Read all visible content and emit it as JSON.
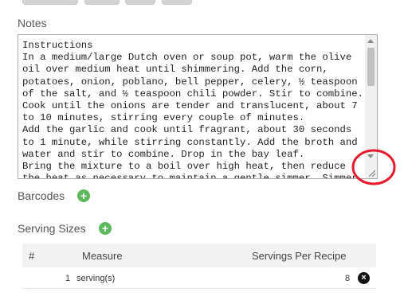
{
  "notes": {
    "label": "Notes",
    "text": "Instructions\nIn a medium/large Dutch oven or soup pot, warm the olive oil over medium heat until shimmering. Add the corn, potatoes, onion, poblano, bell pepper, celery, ½ teaspoon of the salt, and ½ teaspoon chili powder. Stir to combine. Cook until the onions are tender and translucent, about 7 to 10 minutes, stirring every couple of minutes.\nAdd the garlic and cook until fragrant, about 30 seconds to 1 minute, while stirring constantly. Add the broth and water and stir to combine. Drop in the bay leaf.\nBring the mixture to a boil over high heat, then reduce the heat as necessary to maintain a gentle simmer. Simmer"
  },
  "barcodes": {
    "label": "Barcodes"
  },
  "serving_sizes": {
    "label": "Serving Sizes",
    "columns": [
      "#",
      "Measure",
      "Servings Per Recipe"
    ],
    "rows": [
      {
        "num": "1",
        "measure": "serving(s)",
        "servings": "8"
      }
    ]
  },
  "colors": {
    "add_green": "#5cb85c",
    "annotation_red": "#e8192c"
  },
  "icons": {
    "add": "plus-circle-icon",
    "delete": "times-circle-icon",
    "resize": "resize-grip-icon"
  }
}
